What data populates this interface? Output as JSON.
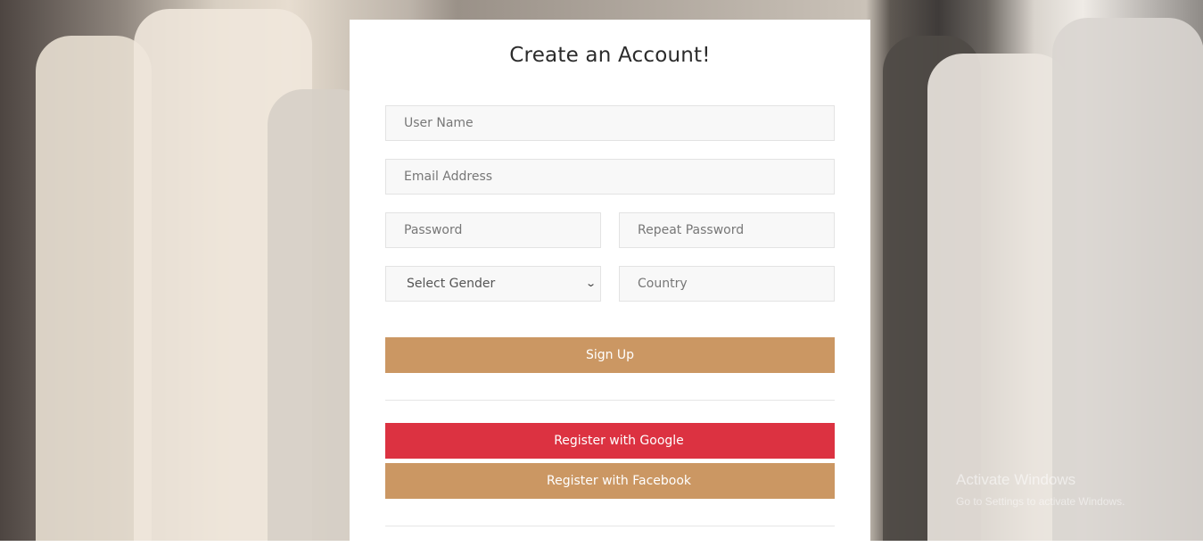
{
  "form": {
    "title": "Create an Account!",
    "username_placeholder": "User Name",
    "email_placeholder": "Email Address",
    "password_placeholder": "Password",
    "repeat_password_placeholder": "Repeat Password",
    "gender_selected": "Select Gender",
    "country_placeholder": "Country",
    "signup_label": "Sign Up",
    "google_label": "Register with Google",
    "facebook_label": "Register with Facebook"
  },
  "watermark": {
    "title": "Activate Windows",
    "subtitle": "Go to Settings to activate Windows."
  },
  "colors": {
    "accent": "#cb9763",
    "google": "#dc3241",
    "card": "#ffffff"
  }
}
